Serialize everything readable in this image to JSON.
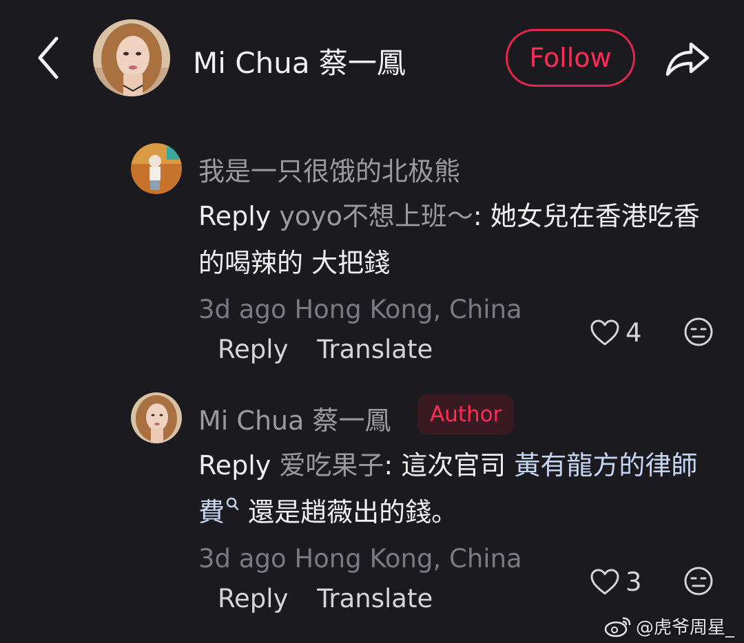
{
  "header": {
    "name": "Mi Chua 蔡一鳳",
    "follow_label": "Follow",
    "accent": "#ff2a55"
  },
  "comments": [
    {
      "username": "我是一只很饿的北极熊",
      "reply_keyword": "Reply",
      "reply_to": "yoyo不想上班～",
      "text": ": 她女兒在香港吃香的喝辣的 大把錢",
      "meta": "3d ago Hong Kong, China",
      "actions": {
        "reply": "Reply",
        "translate": "Translate"
      },
      "likes": "4"
    },
    {
      "username": "Mi Chua 蔡一鳳",
      "badge": "Author",
      "reply_keyword": "Reply",
      "reply_to": "爱吃果子",
      "text_before": ": 這次官司 ",
      "link_text": "黃有龍方的律師費",
      "text_after": " 還是趙薇出的錢。",
      "meta": "3d ago Hong Kong, China",
      "actions": {
        "reply": "Reply",
        "translate": "Translate"
      },
      "likes": "3"
    }
  ],
  "watermark": "@虎爷周星_",
  "icons": {
    "back": "chevron-left-icon",
    "share": "share-arrow-icon",
    "like": "heart-outline-icon",
    "dislike": "meh-face-icon",
    "search": "search-icon",
    "weibo": "weibo-logo-icon"
  }
}
